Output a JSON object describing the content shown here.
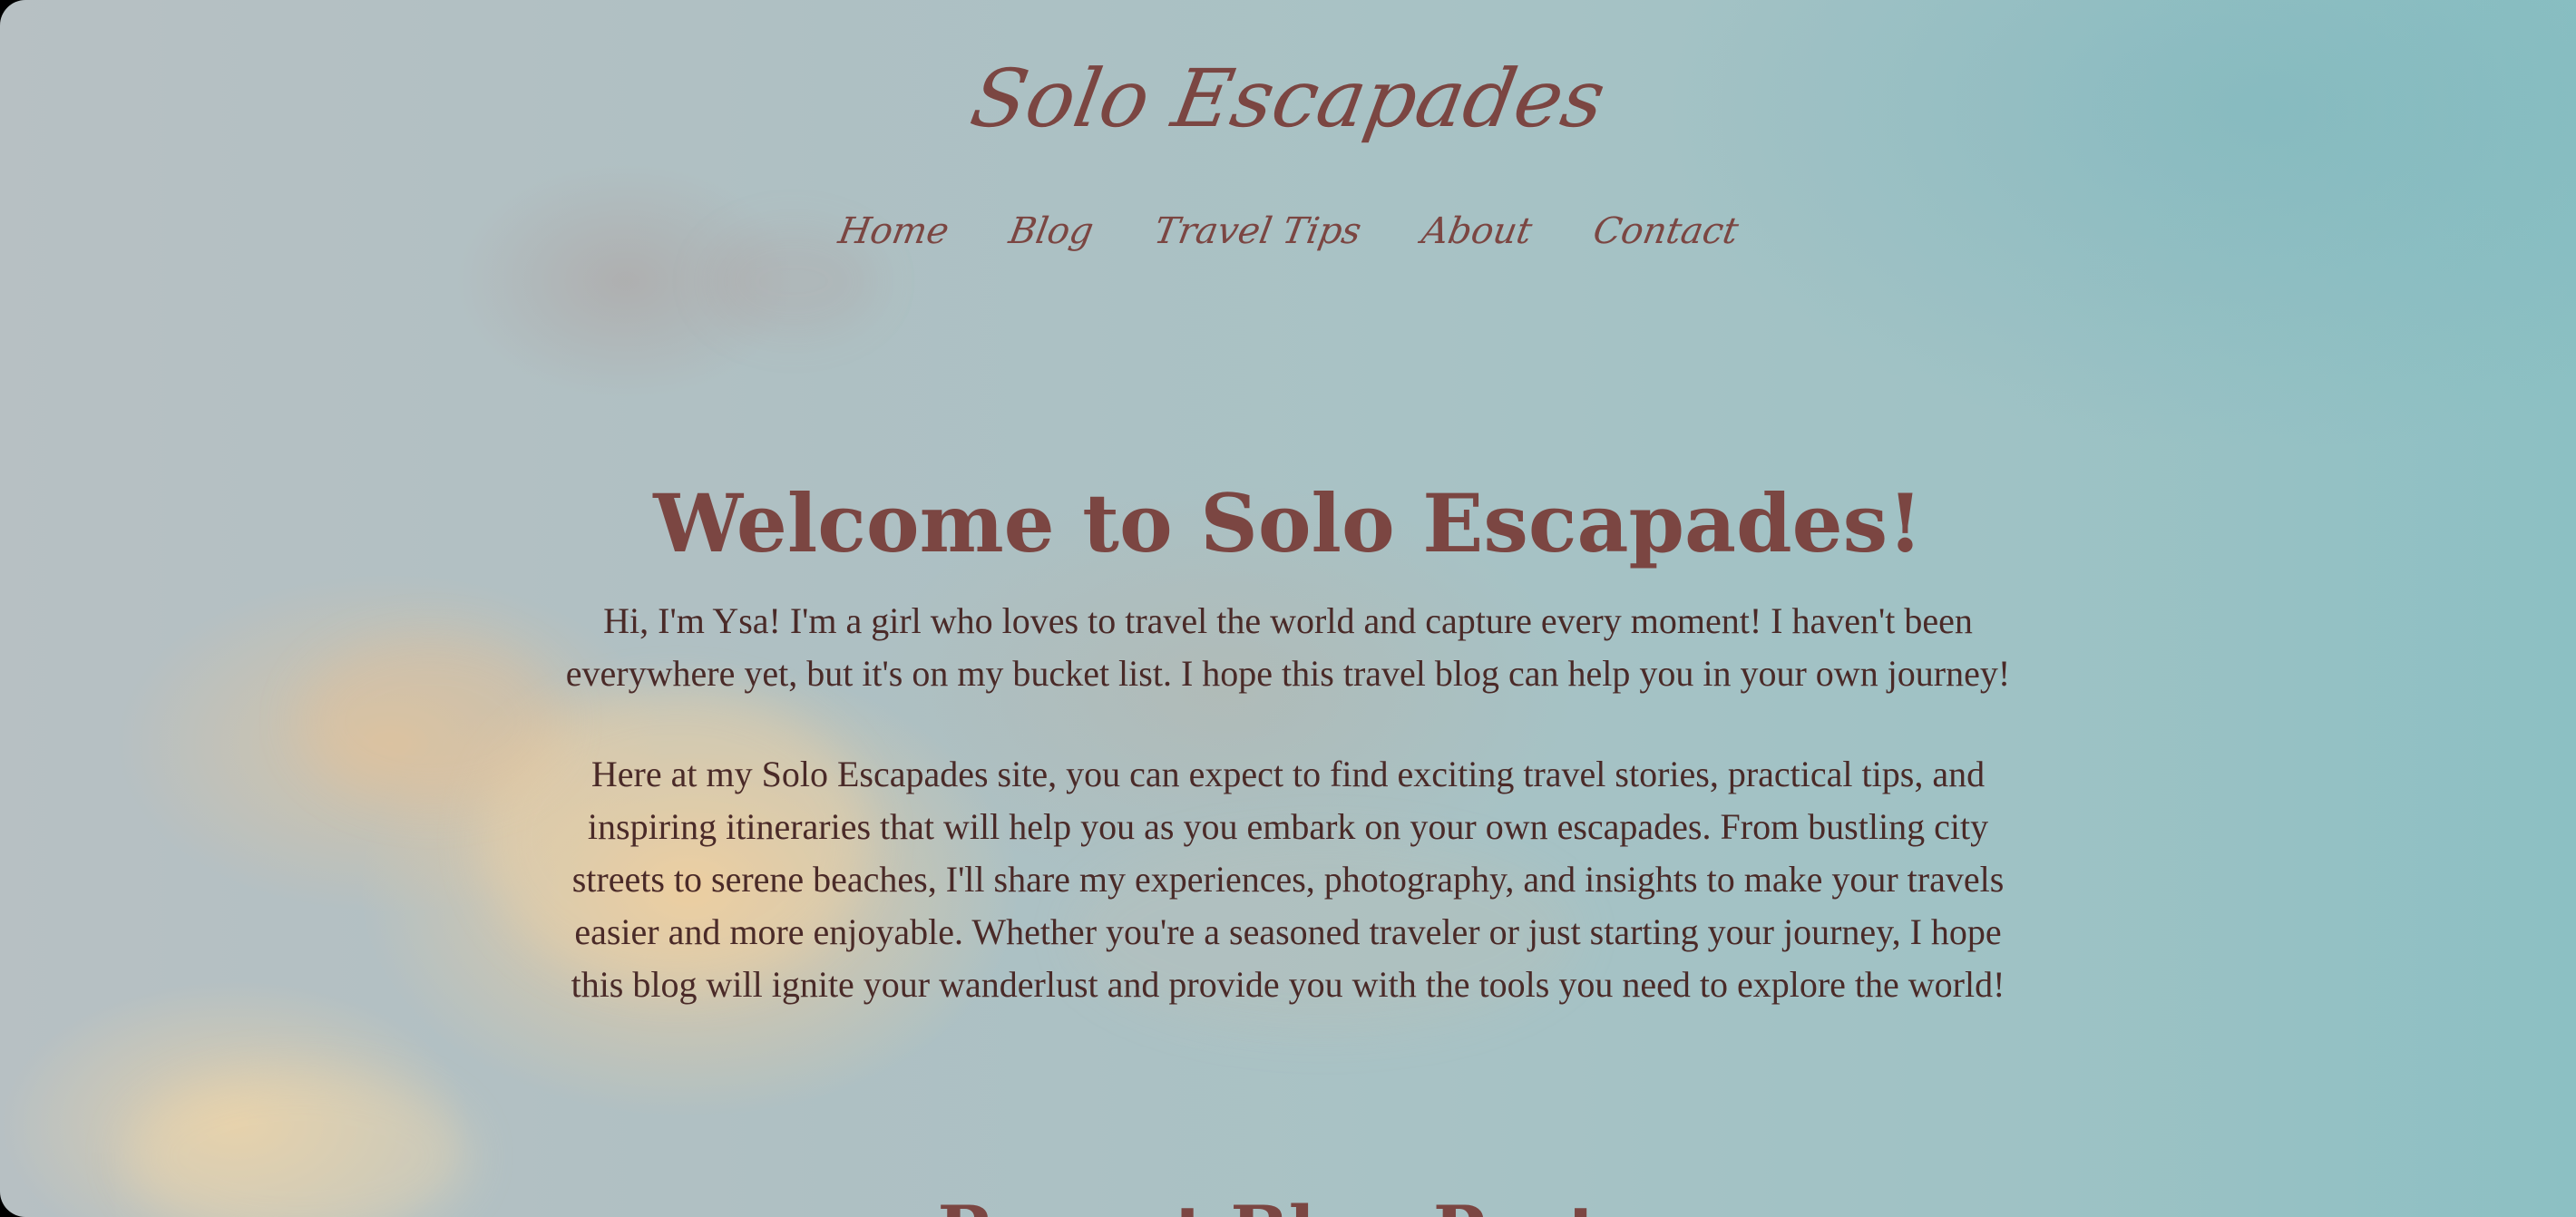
{
  "site": {
    "title": "Solo Escapades"
  },
  "nav": {
    "items": [
      {
        "label": "Home"
      },
      {
        "label": "Blog"
      },
      {
        "label": "Travel Tips"
      },
      {
        "label": "About"
      },
      {
        "label": "Contact"
      }
    ]
  },
  "hero": {
    "title": "Welcome to Solo Escapades!",
    "intro": "Hi, I'm Ysa! I'm a girl who loves to travel the world and capture every moment! I haven't been everywhere yet, but it's on my bucket list. I hope this travel blog can help you in your own journey!",
    "details": "Here at my Solo Escapades site, you can expect to find exciting travel stories, practical tips, and inspiring itineraries that will help you as you embark on your own escapades. From bustling city streets to serene beaches, I'll share my experiences, photography, and insights to make your travels easier and more enjoyable. Whether you're a seasoned traveler or just starting your journey, I hope this blog will ignite your wanderlust and provide you with the tools you need to explore the world!"
  },
  "next_section": {
    "heading_visible_fragment": "Recent Blog Posts"
  },
  "colors": {
    "accent": "#7b4642",
    "text": "#4a2a28",
    "sky_left": "#b7c0c3",
    "sky_right": "#8cc0c3"
  }
}
